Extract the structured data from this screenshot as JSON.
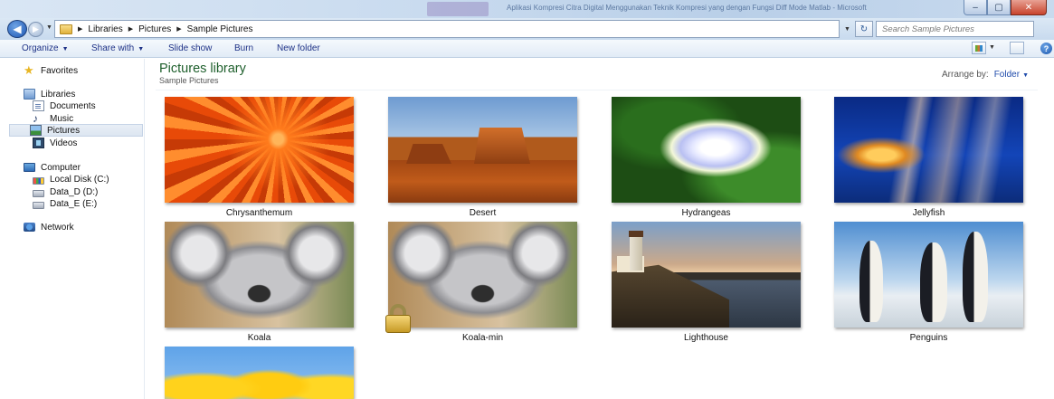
{
  "window": {
    "title": "Aplikasi Kompresi Citra Digital Menggunakan Teknik Kompresi yang dengan Fungsi Diff Mode Matlab - Microsoft",
    "controls": {
      "minimize": "–",
      "maximize": "▢",
      "close": "✕"
    }
  },
  "address": {
    "breadcrumbs": [
      "Libraries",
      "Pictures",
      "Sample Pictures"
    ],
    "search_placeholder": "Search Sample Pictures"
  },
  "toolbar": {
    "organize": "Organize",
    "share_with": "Share with",
    "slide_show": "Slide show",
    "burn": "Burn",
    "new_folder": "New folder"
  },
  "nav": {
    "favorites": "Favorites",
    "libraries": "Libraries",
    "documents": "Documents",
    "music": "Music",
    "pictures": "Pictures",
    "videos": "Videos",
    "computer": "Computer",
    "local_disk": "Local Disk (C:)",
    "data_d": "Data_D (D:)",
    "data_e": "Data_E (E:)",
    "network": "Network"
  },
  "library": {
    "title": "Pictures library",
    "subtitle": "Sample Pictures",
    "arrange_label": "Arrange by:",
    "arrange_value": "Folder"
  },
  "files": [
    {
      "name": "Chrysanthemum"
    },
    {
      "name": "Desert"
    },
    {
      "name": "Hydrangeas"
    },
    {
      "name": "Jellyfish"
    },
    {
      "name": "Koala"
    },
    {
      "name": "Koala-min"
    },
    {
      "name": "Lighthouse"
    },
    {
      "name": "Penguins"
    },
    {
      "name": ""
    }
  ],
  "icons": {
    "back": "back-arrow-icon",
    "forward": "forward-arrow-icon",
    "search": "search-icon",
    "lock": "lock-icon"
  },
  "colors": {
    "library_title": "#1e5f2c",
    "toolbar_text": "#1e3287",
    "link_blue": "#1f4bab"
  }
}
